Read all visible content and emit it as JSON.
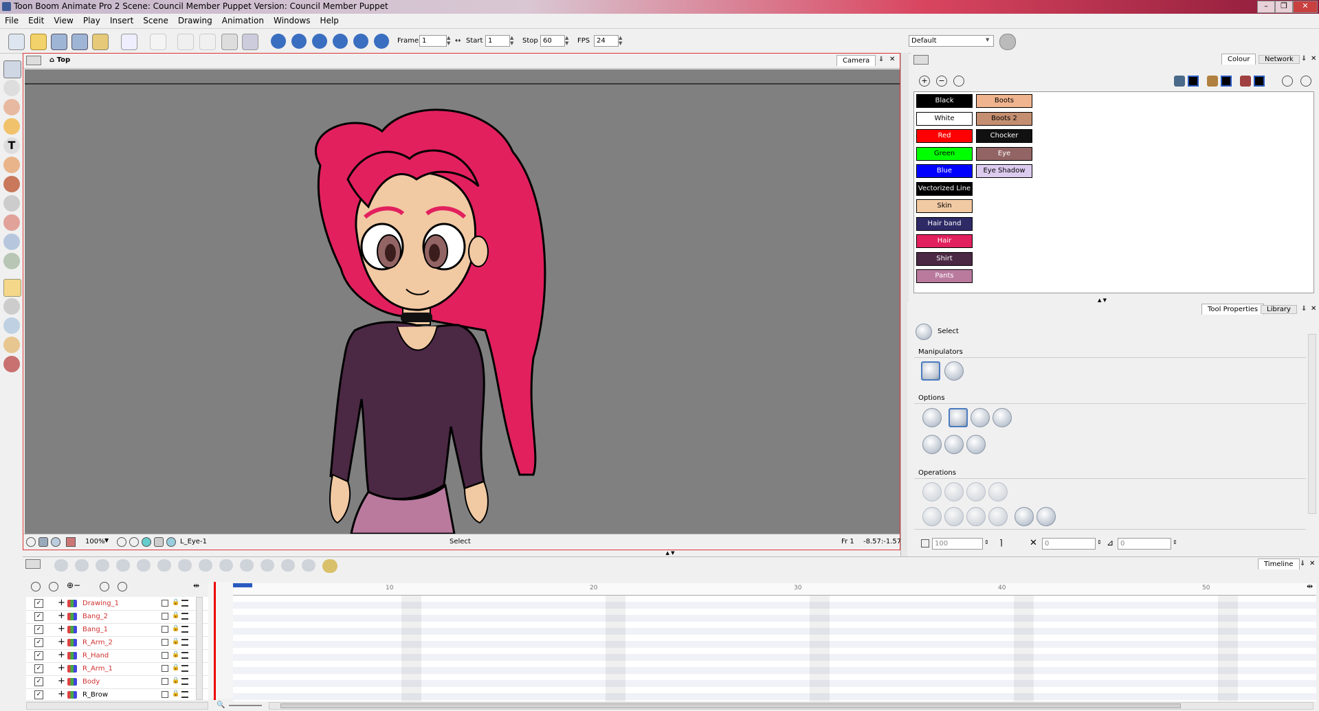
{
  "window": {
    "title": "Toon Boom Animate Pro 2 Scene: Council Member Puppet Version: Council Member Puppet",
    "controls": [
      "–",
      "❐",
      "✕"
    ]
  },
  "menu": [
    "File",
    "Edit",
    "View",
    "Play",
    "Insert",
    "Scene",
    "Drawing",
    "Animation",
    "Windows",
    "Help"
  ],
  "playback": {
    "frame_label": "Frame",
    "frame_value": "1",
    "start_label": "Start",
    "start_value": "1",
    "stop_label": "Stop",
    "stop_value": "60",
    "fps_label": "FPS",
    "fps_value": "24"
  },
  "workspace": {
    "value": "Default"
  },
  "camera_view": {
    "breadcrumb": "Top",
    "tab": "Camera",
    "zoom": "100%",
    "current_drawing": "L_Eye-1",
    "tool": "Select",
    "frame": "Fr 1",
    "coords": "-8.57:-1.57"
  },
  "colour_panel": {
    "tabs": [
      "Colour",
      "Network"
    ],
    "swatches_col1": [
      {
        "name": "Black",
        "color": "#000000",
        "text": "#ffffff"
      },
      {
        "name": "White",
        "color": "#ffffff",
        "text": "#000000"
      },
      {
        "name": "Red",
        "color": "#ff0000",
        "text": "#ffffff"
      },
      {
        "name": "Green",
        "color": "#00ff00",
        "text": "#000000"
      },
      {
        "name": "Blue",
        "color": "#0000ff",
        "text": "#ffffff"
      },
      {
        "name": "Vectorized Line",
        "color": "#000000",
        "text": "#ffffff"
      },
      {
        "name": "Skin",
        "color": "#f1c9a3",
        "text": "#000000"
      },
      {
        "name": "Hair band",
        "color": "#2e2a66",
        "text": "#ffffff"
      },
      {
        "name": "Hair",
        "color": "#e2205e",
        "text": "#ffffff"
      },
      {
        "name": "Shirt",
        "color": "#4b2844",
        "text": "#ffffff"
      },
      {
        "name": "Pants",
        "color": "#b97a9e",
        "text": "#ffffff"
      }
    ],
    "swatches_col2": [
      {
        "name": "Boots",
        "color": "#f0b48e",
        "text": "#000000"
      },
      {
        "name": "Boots 2",
        "color": "#c48e70",
        "text": "#000000"
      },
      {
        "name": "Chocker",
        "color": "#111111",
        "text": "#ffffff"
      },
      {
        "name": "Eye",
        "color": "#936464",
        "text": "#ffffff"
      },
      {
        "name": "Eye Shadow",
        "color": "#dccbee",
        "text": "#000000"
      }
    ]
  },
  "tool_properties": {
    "tabs": [
      "Tool Properties",
      "Library"
    ],
    "tool_name": "Select",
    "manipulators_label": "Manipulators",
    "options_label": "Options",
    "operations_label": "Operations",
    "width_value": "100",
    "x_value": "0",
    "y_value": "0",
    "angle_value": "0"
  },
  "timeline": {
    "tab": "Timeline",
    "ruler": [
      "10",
      "20",
      "30",
      "40",
      "50"
    ],
    "layers": [
      "Drawing_1",
      "Bang_2",
      "Bang_1",
      "R_Arm_2",
      "R_Hand",
      "R_Arm_1",
      "Body",
      "R_Brow"
    ]
  }
}
